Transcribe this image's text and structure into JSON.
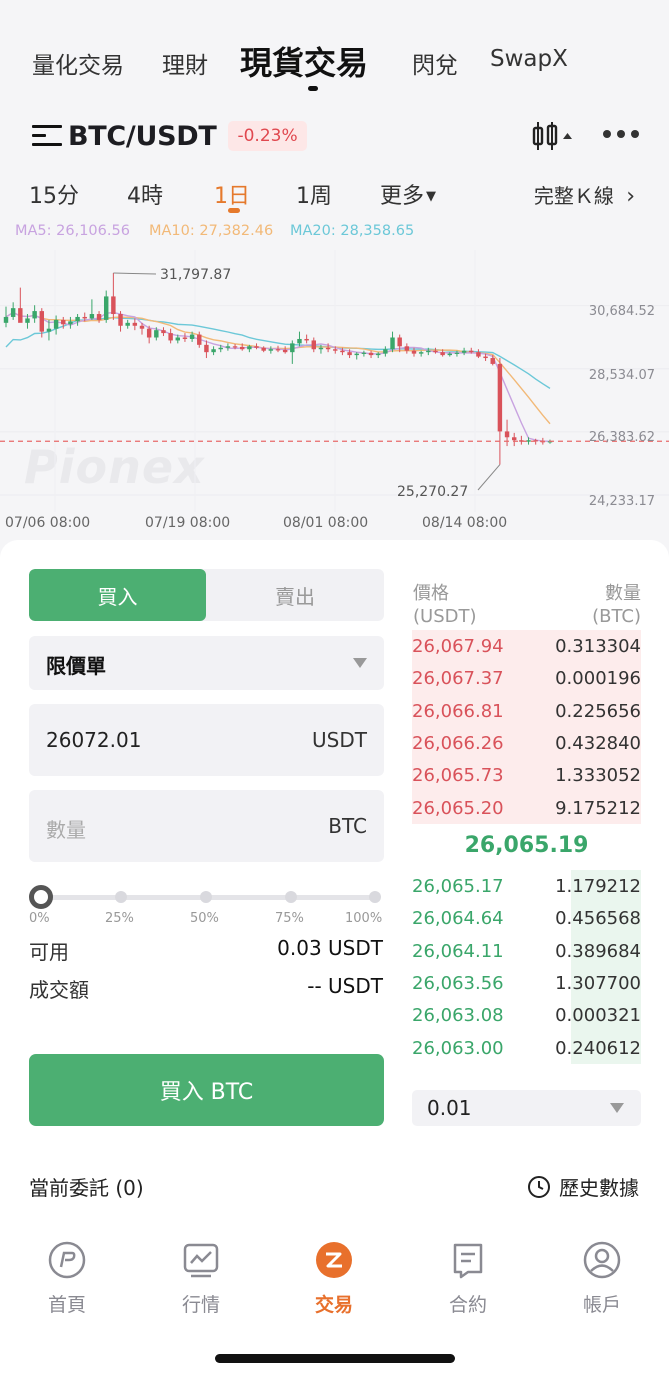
{
  "top_nav": {
    "items": [
      "量化交易",
      "理財",
      "現貨交易",
      "閃兌",
      "SwapX"
    ],
    "active_index": 2
  },
  "pair": {
    "name": "BTC/USDT",
    "change": "-0.23%"
  },
  "timeframes": {
    "items": [
      "15分",
      "4時",
      "1日",
      "1周",
      "更多"
    ],
    "active_index": 2,
    "full_kline": "完整Ｋ線"
  },
  "ma": {
    "ma5": "MA5: 26,106.56",
    "ma10": "MA10: 27,382.46",
    "ma20": "MA20: 28,358.65",
    "colors": {
      "ma5": "#c8a3e0",
      "ma10": "#f2b978",
      "ma20": "#6cc8d8"
    }
  },
  "chart_data": {
    "type": "candlestick",
    "x_ticks": [
      "07/06 08:00",
      "07/19 08:00",
      "08/01 08:00",
      "08/14 08:00"
    ],
    "y_ticks": [
      "30,684.52",
      "28,534.07",
      "26,383.62",
      "24,233.17"
    ],
    "ylim": [
      24233.17,
      31797.87
    ],
    "high_label": "31,797.87",
    "low_label": "25,270.27",
    "current_price_line": 26065.19,
    "candles": [
      {
        "o": 30100,
        "h": 30650,
        "l": 29950,
        "c": 30300
      },
      {
        "o": 30300,
        "h": 30800,
        "l": 30200,
        "c": 30600
      },
      {
        "o": 30600,
        "h": 31300,
        "l": 30400,
        "c": 30100
      },
      {
        "o": 30100,
        "h": 30400,
        "l": 29900,
        "c": 30250
      },
      {
        "o": 30250,
        "h": 30700,
        "l": 30100,
        "c": 30500
      },
      {
        "o": 30500,
        "h": 30600,
        "l": 29600,
        "c": 29800
      },
      {
        "o": 29800,
        "h": 30200,
        "l": 29500,
        "c": 29900
      },
      {
        "o": 29900,
        "h": 30350,
        "l": 29700,
        "c": 30200
      },
      {
        "o": 30200,
        "h": 30300,
        "l": 29900,
        "c": 30050
      },
      {
        "o": 30050,
        "h": 30300,
        "l": 29900,
        "c": 30150
      },
      {
        "o": 30150,
        "h": 30400,
        "l": 30000,
        "c": 30300
      },
      {
        "o": 30300,
        "h": 30450,
        "l": 30150,
        "c": 30250
      },
      {
        "o": 30250,
        "h": 30900,
        "l": 30200,
        "c": 30400
      },
      {
        "o": 30400,
        "h": 30500,
        "l": 30100,
        "c": 30200
      },
      {
        "o": 30200,
        "h": 31200,
        "l": 30100,
        "c": 31000
      },
      {
        "o": 31000,
        "h": 31797.87,
        "l": 30200,
        "c": 30400
      },
      {
        "o": 30400,
        "h": 30500,
        "l": 29800,
        "c": 30000
      },
      {
        "o": 30000,
        "h": 30200,
        "l": 29900,
        "c": 30100
      },
      {
        "o": 30100,
        "h": 30250,
        "l": 29850,
        "c": 30000
      },
      {
        "o": 30000,
        "h": 30100,
        "l": 29700,
        "c": 29900
      },
      {
        "o": 29900,
        "h": 30000,
        "l": 29400,
        "c": 29600
      },
      {
        "o": 29600,
        "h": 29950,
        "l": 29500,
        "c": 29850
      },
      {
        "o": 29850,
        "h": 29950,
        "l": 29650,
        "c": 29750
      },
      {
        "o": 29750,
        "h": 29900,
        "l": 29400,
        "c": 29500
      },
      {
        "o": 29500,
        "h": 29700,
        "l": 29400,
        "c": 29600
      },
      {
        "o": 29600,
        "h": 29750,
        "l": 29450,
        "c": 29550
      },
      {
        "o": 29550,
        "h": 29800,
        "l": 29450,
        "c": 29700
      },
      {
        "o": 29700,
        "h": 29800,
        "l": 29250,
        "c": 29350
      },
      {
        "o": 29350,
        "h": 29500,
        "l": 28900,
        "c": 29100
      },
      {
        "o": 29100,
        "h": 29300,
        "l": 29000,
        "c": 29200
      },
      {
        "o": 29200,
        "h": 29350,
        "l": 29100,
        "c": 29250
      },
      {
        "o": 29250,
        "h": 29400,
        "l": 29150,
        "c": 29300
      },
      {
        "o": 29300,
        "h": 29380,
        "l": 29200,
        "c": 29280
      },
      {
        "o": 29280,
        "h": 29400,
        "l": 29150,
        "c": 29200
      },
      {
        "o": 29200,
        "h": 29350,
        "l": 29100,
        "c": 29300
      },
      {
        "o": 29300,
        "h": 29400,
        "l": 29200,
        "c": 29250
      },
      {
        "o": 29250,
        "h": 29300,
        "l": 29100,
        "c": 29150
      },
      {
        "o": 29150,
        "h": 29300,
        "l": 29050,
        "c": 29200
      },
      {
        "o": 29200,
        "h": 29320,
        "l": 29100,
        "c": 29180
      },
      {
        "o": 29180,
        "h": 29300,
        "l": 29050,
        "c": 29100
      },
      {
        "o": 29100,
        "h": 29500,
        "l": 28700,
        "c": 29400
      },
      {
        "o": 29400,
        "h": 29800,
        "l": 29300,
        "c": 29550
      },
      {
        "o": 29550,
        "h": 29700,
        "l": 29400,
        "c": 29500
      },
      {
        "o": 29500,
        "h": 29600,
        "l": 29100,
        "c": 29200
      },
      {
        "o": 29200,
        "h": 29350,
        "l": 29050,
        "c": 29250
      },
      {
        "o": 29250,
        "h": 29400,
        "l": 29100,
        "c": 29200
      },
      {
        "o": 29200,
        "h": 29300,
        "l": 29050,
        "c": 29150
      },
      {
        "o": 29150,
        "h": 29250,
        "l": 29000,
        "c": 29100
      },
      {
        "o": 29100,
        "h": 29200,
        "l": 28900,
        "c": 29000
      },
      {
        "o": 29000,
        "h": 29100,
        "l": 28850,
        "c": 29050
      },
      {
        "o": 29050,
        "h": 29150,
        "l": 28950,
        "c": 29080
      },
      {
        "o": 29080,
        "h": 29150,
        "l": 28900,
        "c": 29000
      },
      {
        "o": 29000,
        "h": 29100,
        "l": 28900,
        "c": 29050
      },
      {
        "o": 29050,
        "h": 29300,
        "l": 28950,
        "c": 29200
      },
      {
        "o": 29200,
        "h": 29800,
        "l": 29100,
        "c": 29600
      },
      {
        "o": 29600,
        "h": 29700,
        "l": 29100,
        "c": 29300
      },
      {
        "o": 29300,
        "h": 29400,
        "l": 29050,
        "c": 29150
      },
      {
        "o": 29150,
        "h": 29250,
        "l": 28950,
        "c": 29050
      },
      {
        "o": 29050,
        "h": 29150,
        "l": 28950,
        "c": 29100
      },
      {
        "o": 29100,
        "h": 29250,
        "l": 29000,
        "c": 29150
      },
      {
        "o": 29150,
        "h": 29250,
        "l": 29050,
        "c": 29100
      },
      {
        "o": 29100,
        "h": 29200,
        "l": 28950,
        "c": 29000
      },
      {
        "o": 29000,
        "h": 29100,
        "l": 28950,
        "c": 29050
      },
      {
        "o": 29050,
        "h": 29150,
        "l": 28950,
        "c": 29080
      },
      {
        "o": 29080,
        "h": 29250,
        "l": 29000,
        "c": 29150
      },
      {
        "o": 29150,
        "h": 29250,
        "l": 29050,
        "c": 29100
      },
      {
        "o": 29100,
        "h": 29200,
        "l": 28900,
        "c": 28950
      },
      {
        "o": 28950,
        "h": 29050,
        "l": 28800,
        "c": 28900
      },
      {
        "o": 28900,
        "h": 29000,
        "l": 28650,
        "c": 28700
      },
      {
        "o": 28700,
        "h": 28900,
        "l": 25270.27,
        "c": 26400
      },
      {
        "o": 26400,
        "h": 26800,
        "l": 25900,
        "c": 26200
      },
      {
        "o": 26200,
        "h": 26350,
        "l": 25900,
        "c": 26100
      },
      {
        "o": 26100,
        "h": 26250,
        "l": 25950,
        "c": 26050
      },
      {
        "o": 26050,
        "h": 26200,
        "l": 25950,
        "c": 26100
      },
      {
        "o": 26100,
        "h": 26150,
        "l": 25950,
        "c": 26070
      },
      {
        "o": 26070,
        "h": 26180,
        "l": 25950,
        "c": 26030
      },
      {
        "o": 26030,
        "h": 26120,
        "l": 25980,
        "c": 26065.19
      }
    ]
  },
  "order_form": {
    "buy_label": "買入",
    "sell_label": "賣出",
    "order_type": "限價單",
    "price_value": "26072.01",
    "price_unit": "USDT",
    "amount_placeholder": "數量",
    "amount_unit": "BTC",
    "slider_percent": 0,
    "slider_labels": [
      "0%",
      "25%",
      "50%",
      "75%",
      "100%"
    ],
    "available_label": "可用",
    "available_value": "0.03 USDT",
    "turnover_label": "成交額",
    "turnover_value": "-- USDT",
    "submit_label": "買入 BTC"
  },
  "order_book": {
    "price_header": "價格",
    "price_unit": "(USDT)",
    "qty_header": "數量",
    "qty_unit": "(BTC)",
    "asks": [
      {
        "price": "26,067.94",
        "qty": "0.313304"
      },
      {
        "price": "26,067.37",
        "qty": "0.000196"
      },
      {
        "price": "26,066.81",
        "qty": "0.225656"
      },
      {
        "price": "26,066.26",
        "qty": "0.432840"
      },
      {
        "price": "26,065.73",
        "qty": "1.333052"
      },
      {
        "price": "26,065.20",
        "qty": "9.175212"
      }
    ],
    "mid_price": "26,065.19",
    "bids": [
      {
        "price": "26,065.17",
        "qty": "1.179212"
      },
      {
        "price": "26,064.64",
        "qty": "0.456568"
      },
      {
        "price": "26,064.11",
        "qty": "0.389684"
      },
      {
        "price": "26,063.56",
        "qty": "1.307700"
      },
      {
        "price": "26,063.08",
        "qty": "0.000321"
      },
      {
        "price": "26,063.00",
        "qty": "0.240612"
      }
    ],
    "precision": "0.01",
    "colors": {
      "ask": "#d9525a",
      "bid": "#3aa66a"
    }
  },
  "footer": {
    "orders_label": "當前委託 (0)",
    "history_label": "歷史數據"
  },
  "tab_bar": {
    "items": [
      "首頁",
      "行情",
      "交易",
      "合約",
      "帳戶"
    ],
    "active_index": 2,
    "accent": "#e8702c"
  },
  "watermark": "Pionex"
}
